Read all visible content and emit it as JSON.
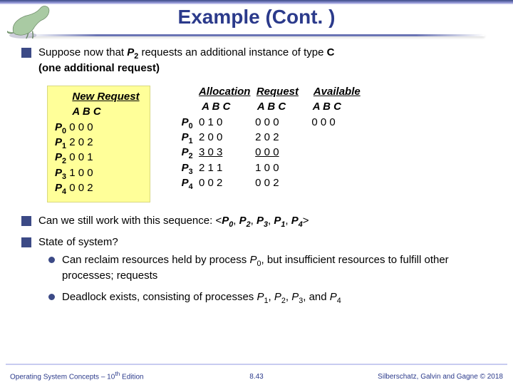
{
  "title": "Example (Cont. )",
  "intro_prefix": "Suppose now that ",
  "intro_proc": "P",
  "intro_proc_sub": "2",
  "intro_mid": " requests an additional instance of type ",
  "intro_type": "C",
  "intro_line2": "(one additional request)",
  "new_request": {
    "title": "New Request",
    "header": "A B C",
    "rows": [
      {
        "p": "P",
        "i": "0",
        "vals": " 0 0 0"
      },
      {
        "p": "P",
        "i": "1",
        "vals": " 2 0 2"
      },
      {
        "p": "P",
        "i": "2",
        "vals": " 0 0 1"
      },
      {
        "p": "P",
        "i": "3",
        "vals": " 1 0 0"
      },
      {
        "p": "P",
        "i": "4",
        "vals": " 0 0 2"
      }
    ]
  },
  "alloc": {
    "title": "Allocation",
    "header": "A B C",
    "rows": [
      {
        "p": "P",
        "i": "0",
        "vals": "0 1 0"
      },
      {
        "p": "P",
        "i": "1",
        "vals": "2 0 0"
      },
      {
        "p": "P",
        "i": "2",
        "vals": "3 0 3",
        "u": true
      },
      {
        "p": "P",
        "i": "3",
        "vals": "2 1 1"
      },
      {
        "p": "P",
        "i": "4",
        "vals": "0 0 2"
      }
    ]
  },
  "request": {
    "title": "Request",
    "header": "A B C",
    "rows": [
      {
        "vals": "0 0 0"
      },
      {
        "vals": "2 0 2"
      },
      {
        "vals": "0 0 0",
        "u": true
      },
      {
        "vals": "1 0 0"
      },
      {
        "vals": "0 0 2"
      }
    ]
  },
  "available": {
    "title": "Available",
    "header": "A B C",
    "vals": "0 0 0"
  },
  "q1_prefix": "Can we still work with this sequence: <",
  "seq": [
    {
      "p": "P",
      "i": "0"
    },
    {
      "p": "P",
      "i": "2"
    },
    {
      "p": "P",
      "i": "3"
    },
    {
      "p": "P",
      "i": "1"
    },
    {
      "p": "P",
      "i": "4"
    }
  ],
  "q1_suffix": ">",
  "q2": "State of system?",
  "sub1_a": "Can reclaim resources held by process ",
  "sub1_p": "P",
  "sub1_i": "0",
  "sub1_b": ", but insufficient resources to fulfill other processes; requests",
  "sub2_a": "Deadlock exists, consisting of processes ",
  "dl": [
    {
      "p": "P",
      "i": "1"
    },
    {
      "p": "P",
      "i": "2"
    },
    {
      "p": "P",
      "i": "3"
    },
    {
      "p": "P",
      "i": "4"
    }
  ],
  "sub2_join": ",  ",
  "sub2_and": ", and ",
  "footer_left_a": "Operating System Concepts – 10",
  "footer_left_sup": "th",
  "footer_left_b": " Edition",
  "footer_center": "8.43",
  "footer_right_a": "Silberschatz, Galvin and Gagne ",
  "footer_right_b": "2018",
  "copyright": "©"
}
